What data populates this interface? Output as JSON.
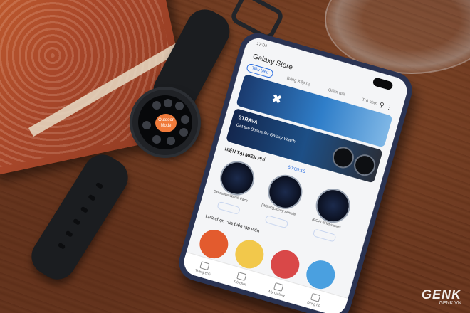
{
  "scene": {
    "description_colors": {
      "table": "#5a2f1c",
      "book": "#b04e2a",
      "watch": "#1b1d20",
      "phone_frame": "#2a3352",
      "accent_blue": "#2c6fe0",
      "watch_accent": "#f07a3a"
    }
  },
  "watch": {
    "center_label": "Outdoor Mode",
    "icons": [
      "app-icon",
      "app-icon",
      "app-icon",
      "app-icon",
      "app-icon",
      "app-icon",
      "app-icon",
      "app-icon"
    ]
  },
  "phone": {
    "status_time": "17:04",
    "app_title": "Galaxy Store",
    "tabs": [
      {
        "label": "Tiêu biểu",
        "active": true
      },
      {
        "label": "Bảng Xếp hạ",
        "active": false
      },
      {
        "label": "Giảm giá",
        "active": false
      },
      {
        "label": "Trò chơi",
        "active": false
      },
      {
        "label": "Thể loại",
        "active": false
      }
    ],
    "banner2_title": "STRAVA",
    "banner2_subtitle": "Get the Strava for Galaxy Watch",
    "section_title": "HIỆN TẠI MIỄN PHÍ",
    "countdown": "60:00:16",
    "faces": [
      {
        "name": "Executive Watch Face"
      },
      {
        "name": "[ROAD]Luxury sample"
      },
      {
        "name": "[ROAD]Flat stones"
      }
    ],
    "section2_title": "Lựa chọn của biên tập viên",
    "bottom_nav": [
      {
        "label": "Trang chủ",
        "icon": "home-icon"
      },
      {
        "label": "Trò chơi",
        "icon": "game-icon"
      },
      {
        "label": "My Galaxy",
        "icon": "galaxy-icon"
      },
      {
        "label": "Đồng hồ",
        "icon": "watch-icon"
      }
    ]
  },
  "watermark": {
    "logo": "GENK",
    "domain": "GENK.VN"
  }
}
